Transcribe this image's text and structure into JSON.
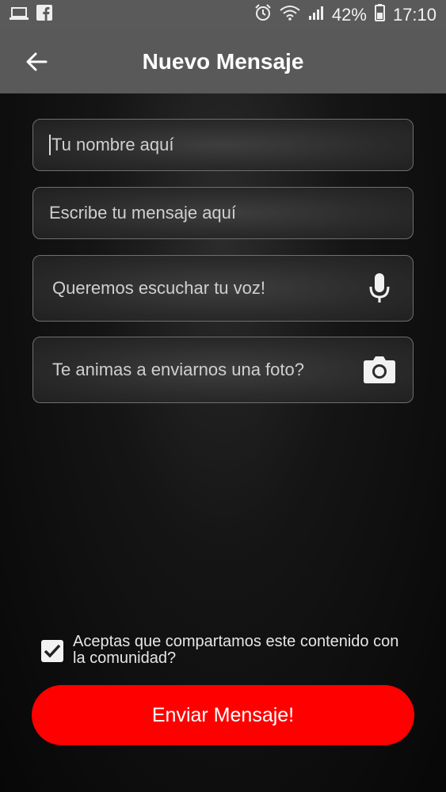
{
  "status_bar": {
    "battery": "42%",
    "time": "17:10"
  },
  "header": {
    "title": "Nuevo Mensaje"
  },
  "form": {
    "name_placeholder": "Tu nombre aquí",
    "message_placeholder": "Escribe tu mensaje aquí",
    "voice_label": "Queremos escuchar tu voz!",
    "photo_label": "Te animas a enviarnos una foto?",
    "consent_label": "Aceptas que compartamos este contenido con la comunidad?",
    "consent_checked": true,
    "submit_label": "Enviar Mensaje!"
  },
  "colors": {
    "accent": "#ff0000",
    "bar": "#595959"
  }
}
